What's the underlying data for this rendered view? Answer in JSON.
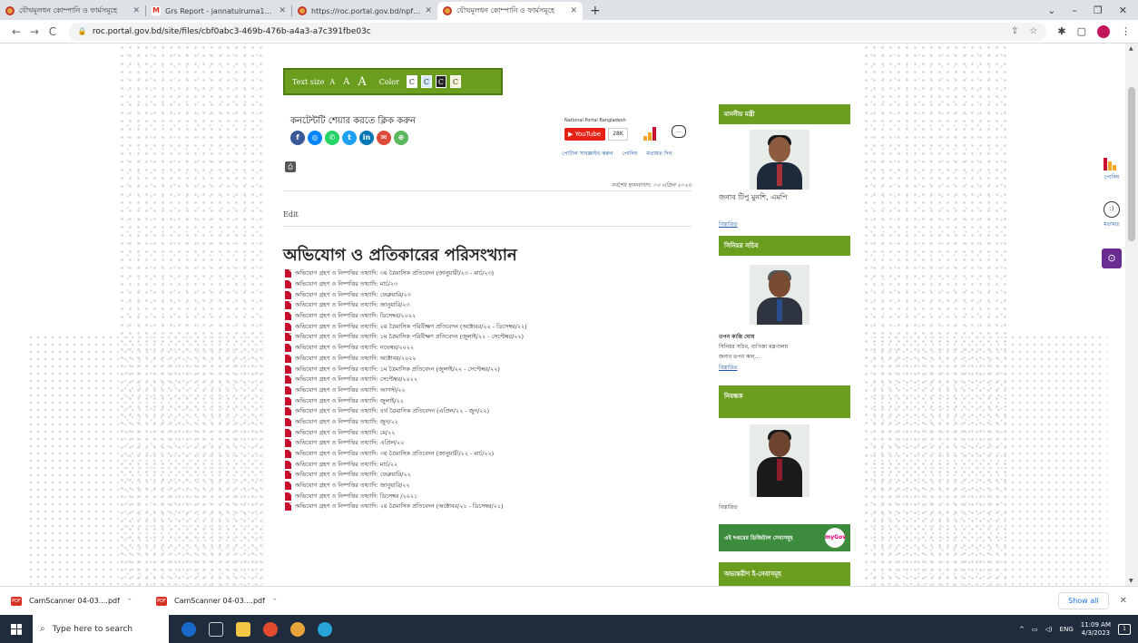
{
  "browser": {
    "tabs": [
      {
        "title": "যৌথমূলধন কোম্পানি ও ফার্মসমূহে",
        "favicon": "gov-icon",
        "active": false
      },
      {
        "title": "Grs Report - jannatulruma18@g",
        "favicon": "gmail-icon",
        "active": false
      },
      {
        "title": "https://roc.portal.gov.bd/npfadm",
        "favicon": "gov-icon",
        "active": false
      },
      {
        "title": "যৌথমূলধন কোম্পানি ও ফার্মসমূহে",
        "favicon": "gov-icon",
        "active": true
      }
    ],
    "new_tab": "+",
    "window_controls": {
      "dropdown": "⌄",
      "minimize": "–",
      "maximize": "❐",
      "close": "✕"
    },
    "url": "roc.portal.gov.bd/site/files/cbf0abc3-469b-476b-a4a3-a7c391fbe03c"
  },
  "accessibility_bar": {
    "text_size_label": "Text size",
    "sizes": [
      "A",
      "A",
      "A"
    ],
    "color_label": "Color",
    "swatches": [
      {
        "label": "C",
        "bg": "#ffffff",
        "fg": "#333333"
      },
      {
        "label": "C",
        "bg": "#d6eaff",
        "fg": "#333333"
      },
      {
        "label": "C",
        "bg": "#222222",
        "fg": "#ffffff"
      },
      {
        "label": "C",
        "bg": "#f7f5d8",
        "fg": "#333333"
      }
    ]
  },
  "share": {
    "title": "কনটেন্টটি শেয়ার করতে ক্লিক করুন",
    "icons": [
      {
        "name": "facebook-icon",
        "glyph": "f",
        "color": "#3b5998"
      },
      {
        "name": "messenger-icon",
        "glyph": "◎",
        "color": "#0084ff"
      },
      {
        "name": "whatsapp-icon",
        "glyph": "✆",
        "color": "#25d366"
      },
      {
        "name": "twitter-icon",
        "glyph": "t",
        "color": "#1da1f2"
      },
      {
        "name": "linkedin-icon",
        "glyph": "in",
        "color": "#0077b5"
      },
      {
        "name": "email-icon",
        "glyph": "✉",
        "color": "#dd4b39"
      },
      {
        "name": "share-more-icon",
        "glyph": "⊕",
        "color": "#5cb85c"
      }
    ],
    "print_icon": "⎙"
  },
  "portal": {
    "national_portal": "National Portal Bangladesh",
    "youtube_label": "YouTube",
    "youtube_count": "28K",
    "subscribe_link": "পোর্টাল সাবস্ক্রাইব করুন",
    "poll_link": "পোলিং",
    "feedback_link": "মতামত দিন"
  },
  "last_updated": "সর্বশেষ হালনাগাদ: ০৩ এপ্রিল ২০২৩",
  "edit_label": "Edit",
  "heading": "অভিযোগ ও প্রতিকারের পরিসংখ্যান",
  "documents": [
    "অভিযোগ গ্রহণ ও নিষ্পত্তির তথ্যাদি: ৩য় ত্রৈমাসিক প্রতিবেদন (জানুয়ারী/২৩ - মার্চ/২৩)",
    "অভিযোগ গ্রহণ ও নিষ্পত্তির তথ্যাদি: মার্চ/২৩",
    "অভিযোগ গ্রহণ ও নিষ্পত্তির তথ্যাদি: ফেব্রুয়ারি/২৩",
    "অভিযোগ গ্রহণ ও নিষ্পত্তির তথ্যাদি: জানুয়ারি/২৩",
    "অভিযোগ গ্রহণ ও নিষ্পত্তির তথ্যাদি: ডিসেম্বর/২০২২",
    "অভিযোগ গ্রহণ ও নিষ্পত্তির তথ্যাদি: ২য় ত্রৈমাসিক পরিবীক্ষণ প্রতিবেদন (অক্টোবর/২২ - ডিসেম্বর/২২)",
    "অভিযোগ গ্রহণ ও নিষ্পত্তির তথ্যাদি: ১ম ত্রৈমাসিক পরিবীক্ষণ প্রতিবেদন (জুলাই/২২ - সেপ্টেম্বর/২২)",
    "অভিযোগ গ্রহণ ও নিষ্পত্তির তথ্যাদি: নভেম্বর/২০২২",
    "অভিযোগ গ্রহণ ও নিষ্পত্তির তথ্যাদি: অক্টোবর/২০২২",
    "অভিযোগ গ্রহণ ও নিষ্পত্তির তথ্যাদি: ১ম ত্রৈমাসিক প্রতিবেদন (জুলাই/২২ - সেপ্টেম্বর/২২)",
    "অভিযোগ গ্রহণ ও নিষ্পত্তির তথ্যাদি: সেপ্টেম্বর/২০২২",
    "অভিযোগ গ্রহণ ও নিষ্পত্তির তথ্যাদি: আগস্ট/২২",
    "অভিযোগ গ্রহণ ও নিষ্পত্তির তথ্যাদি: জুলাই/২২",
    "অভিযোগ গ্রহণ ও নিষ্পত্তির তথ্যাদি: ৪র্থ ত্রৈমাসিক প্রতিবেদন (এপ্রিল/২২ - জুন/২২)",
    "অভিযোগ গ্রহণ ও নিষ্পত্তির তথ্যাদি: জুন/২২",
    "অভিযোগ গ্রহণ ও নিষ্পত্তির তথ্যাদি: মে/২২",
    "অভিযোগ গ্রহণ ও নিষ্পত্তির তথ্যাদি: এপ্রিল/২২",
    "অভিযোগ গ্রহণ ও নিষ্পত্তির তথ্যাদি: ৩য় ত্রৈমাসিক প্রতিবেদন (জানুয়ারী/২২ - মার্চ/২২)",
    "অভিযোগ গ্রহণ ও নিষ্পত্তির তথ্যাদি: মার্চ/২২",
    "অভিযোগ গ্রহণ ও নিষ্পত্তির তথ্যাদি: ফেব্রুয়ারি/২২",
    "অভিযোগ গ্রহণ ও নিষ্পত্তির তথ্যাদি: জানুয়ারি/২২",
    "অভিযোগ গ্রহণ ও নিষ্পত্তির তথ্যাদি: ডিসেম্বর /২০২১",
    "অভিযোগ গ্রহণ ও নিষ্পত্তির তথ্যাদি: ২য় ত্রৈমাসিক প্রতিবেদন (অক্টোবর/২১ - ডিসেম্বর/২১)"
  ],
  "sidebar": {
    "minister": {
      "title": "মাননীয় মন্ত্রী",
      "name": "জনাব টিপু মুনশি, এমপি",
      "more": "বিস্তারিত"
    },
    "secretary": {
      "title": "সিনিয়র সচিব",
      "name": "তপন কান্তি ঘোষ",
      "desc1": "সিনিয়র সচিব, বাণিজ্য মন্ত্রণালয়",
      "desc2": "জনাব তপন কান্‌...",
      "more": "বিস্তারিত"
    },
    "registrar": {
      "title": "নিবন্ধক",
      "more": "বিস্তারিত"
    },
    "mygov": {
      "label": "এই দপ্তরের ডিজিটাল সেবাসমূহ",
      "logo": "myGov"
    },
    "eservices": {
      "title": "অভ্যন্তরীণ ই-সেবাসমূহ"
    }
  },
  "dock": {
    "poll_label": "পোলিং",
    "feedback_label": "মতামত",
    "access_glyph": "⊙"
  },
  "downloads": [
    {
      "name": "CamScanner 04-03....pdf"
    },
    {
      "name": "CamScanner 04-03....pdf"
    }
  ],
  "show_all": "Show all",
  "taskbar": {
    "search_placeholder": "Type here to search",
    "lang": "ENG",
    "time": "11:09 AM",
    "date": "4/3/2023"
  },
  "colors": {
    "accent_green": "#6b9e1f",
    "pdf_red": "#c8102e",
    "link_blue": "#1a5aa8"
  }
}
